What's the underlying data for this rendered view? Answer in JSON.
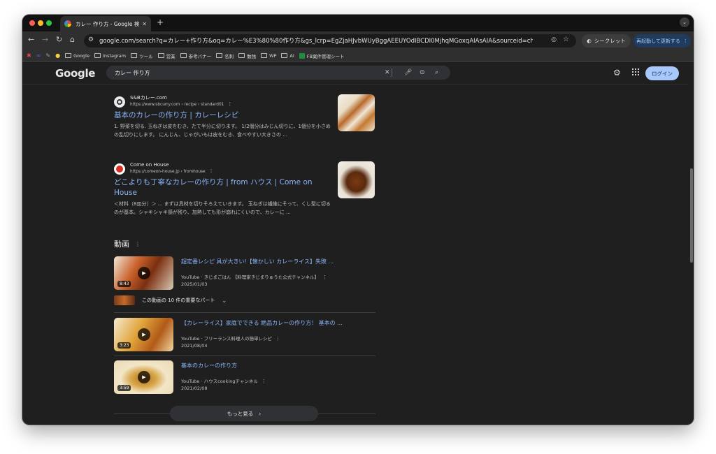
{
  "browser": {
    "tab_title": "カレー 作り方 - Google 検索",
    "new_tab_icon": "+",
    "url": "google.com/search?q=カレー+作り方&oq=カレー%E3%80%80作り方&gs_lcrp=EgZjaHJvbWUyBggAEEUYOdIBCDI0MjhqMGoxqAIAsAIA&sourceid=chrome&ie=UTF-8&sei...",
    "incognito_label": "シークレット",
    "relaunch_label": "再起動して更新する",
    "colors": {
      "frame": "#121212",
      "toolbar": "#2f2f2f",
      "accent": "#a8c7fa"
    }
  },
  "bookmarks": [
    {
      "label": "Google"
    },
    {
      "label": "Instagram"
    },
    {
      "label": "ツール"
    },
    {
      "label": "営業"
    },
    {
      "label": "参考バナー"
    },
    {
      "label": "名刺"
    },
    {
      "label": "勉強"
    },
    {
      "label": "WP"
    },
    {
      "label": "AI"
    },
    {
      "label": "FB案件管理シート"
    }
  ],
  "google": {
    "logo": "Google",
    "query": "カレー 作り方",
    "login_label": "ログイン"
  },
  "results": [
    {
      "site": "S&Bカレー.com",
      "url": "https://www.sbcurry.com › recipe › standard01",
      "title": "基本のカレーの作り方 | カレーレシピ",
      "snippet": "1. 野菜を切る. 玉ねぎは皮をむき、たて半分に切ります。 1/2個分はみじん切りに、1個分を小さめの乱切りにします。 にんじん、じゃがいもは皮をむき、食べやすい大きさの ..."
    },
    {
      "site": "Come on House",
      "url": "https://comeon-house.jp › fromhouse",
      "title": "どこよりも丁寧なカレーの作り方 | from ハウス | Come on House",
      "snippet": "＜材料（8皿分）＞ ... まずは具材を切りそろえていきます。 玉ねぎは繊維にそって、くし型に切るのが基本。シャキシャキ感が残り、加熱しても形が崩れにくいので、カレーに ..."
    }
  ],
  "videos": {
    "heading": "動画",
    "key_moments_label": "この動画の 10 件の重要なパート",
    "more_label": "もっと見る",
    "items": [
      {
        "title": "超定番レシピ 具が大きい!【懐かしい カレーライス】失敗 ...",
        "meta": "YouTube · きじまごはん 【料理家きじまりゅうた公式チャンネル】",
        "date": "2025/01/03",
        "duration": "8:43"
      },
      {
        "title": "【カレーライス】家庭でできる 絶品カレーの作り方！ 基本の ...",
        "meta": "YouTube · フリーランス料理人の簡単レシピ",
        "date": "2021/08/04",
        "duration": "3:23"
      },
      {
        "title": "基本のカレーの作り方",
        "meta": "YouTube · ハウスcookingチャンネル",
        "date": "2021/02/08",
        "duration": "3:59"
      }
    ]
  }
}
